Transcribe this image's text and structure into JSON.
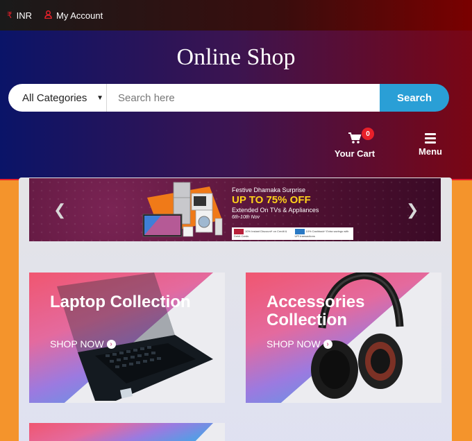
{
  "topbar": {
    "currency": "INR",
    "account": "My Account"
  },
  "header": {
    "title": "Online Shop",
    "category": "All Categories",
    "search_placeholder": "Search here",
    "search_button": "Search",
    "cart_count": "0",
    "cart_label": "Your Cart",
    "menu_label": "Menu"
  },
  "banner": {
    "line1": "Festive Dhamaka Surprise",
    "line2": "UP TO 75% OFF",
    "line3": "Extended On TVs & Appliances",
    "line4": "6th-10th Nov",
    "offer1": "10% Instant Discount* on Credit & Debit Cards",
    "offer2": "10% Cashback* Extra savings with UPI transactions"
  },
  "cards": [
    {
      "title": "Laptop Collection",
      "cta": "SHOP NOW"
    },
    {
      "title": "Accessories Collection",
      "cta": "SHOP NOW"
    }
  ],
  "colors": {
    "accent": "#2a9fd6",
    "badge": "#e8202a",
    "page_bg": "#f4942c"
  }
}
